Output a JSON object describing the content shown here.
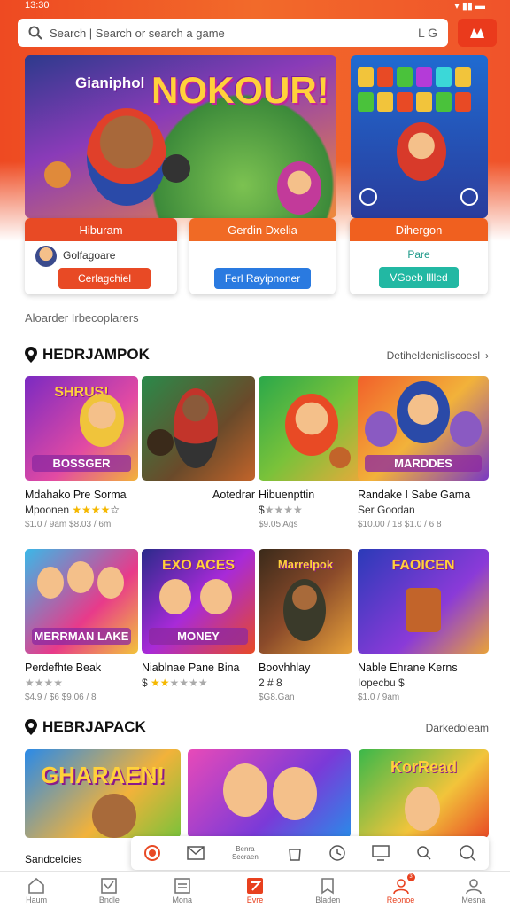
{
  "status": {
    "time": "13:30"
  },
  "search": {
    "placeholder": "Search | Search or search a game",
    "right_label": "L G"
  },
  "banner_main": {
    "subtitle": "Gianiphol",
    "title": "NOKOUR!"
  },
  "promo_cards": [
    {
      "header": "Hiburam",
      "user": "Golfagoare",
      "button": "Cerlagchiel"
    },
    {
      "header": "Gerdin Dxelia",
      "button": "Ferl Rayipnoner"
    },
    {
      "header": "Dihergon",
      "status": "Pare",
      "button": "VGoeb Illled"
    }
  ],
  "note": "Aloarder Irbecoplarers",
  "sections": [
    {
      "title": "HEDRJAMPOK",
      "see_all": "Detiheldenisliscoesl"
    },
    {
      "title": "HEBRJAPACK",
      "see_all": "Darkedoleam"
    }
  ],
  "games_row1": [
    {
      "logo": "SHRUS!",
      "banner": "BOSSGER",
      "title": "Mdahako Pre Sorma",
      "sub": "Mpoonen",
      "meta": "$1.0 / 9am   $8.03 / 6m"
    },
    {
      "logo": "",
      "banner": "",
      "title": "Aotedrar",
      "sub": "",
      "meta": ""
    },
    {
      "logo": "",
      "banner": "",
      "title": "Hibuenpttin",
      "sub": "$",
      "meta": "$9.05 Ags"
    },
    {
      "logo": "",
      "banner": "MARDDES",
      "title": "Randake I Sabe Gama",
      "sub": "Ser Goodan",
      "meta": "$10.00 / 18   $1.0 / 6 8"
    }
  ],
  "games_row2": [
    {
      "logo": "",
      "banner": "MERRMAN LAKE",
      "title": "Perdefhte Beak",
      "sub": "",
      "meta": "$4.9 / $6   $9.06 / 8"
    },
    {
      "logo": "EXO ACES",
      "banner": "MONEY",
      "title": "Niablnae Pane Bina",
      "sub": "$",
      "meta": ""
    },
    {
      "logo": "Marrelpok",
      "banner": "",
      "title": "Boovhhlay",
      "sub": "2 # 8",
      "meta": "$G8.Gan"
    },
    {
      "logo": "FAOICEN",
      "banner": "",
      "title": "Nable Ehrane Kerns",
      "sub": "Iopecbu $",
      "meta": "$1.0 / 9am"
    }
  ],
  "games_row3": [
    {
      "logo": "GHARAEN!"
    },
    {
      "logo": ""
    },
    {
      "logo": "KorRead"
    }
  ],
  "floatbar_label": "Benra Secraen",
  "bottom_label": "Sandcelcies",
  "tabs": [
    {
      "label": "Haum",
      "icon": "home-icon"
    },
    {
      "label": "Bndle",
      "icon": "chart-icon"
    },
    {
      "label": "Mona",
      "icon": "list-icon"
    },
    {
      "label": "Evre",
      "icon": "grid-icon"
    },
    {
      "label": "Bladen",
      "icon": "bookmark-icon"
    },
    {
      "label": "Reonoe",
      "icon": "user-icon",
      "badge": "3"
    },
    {
      "label": "Mesna",
      "icon": "profile-icon"
    }
  ]
}
